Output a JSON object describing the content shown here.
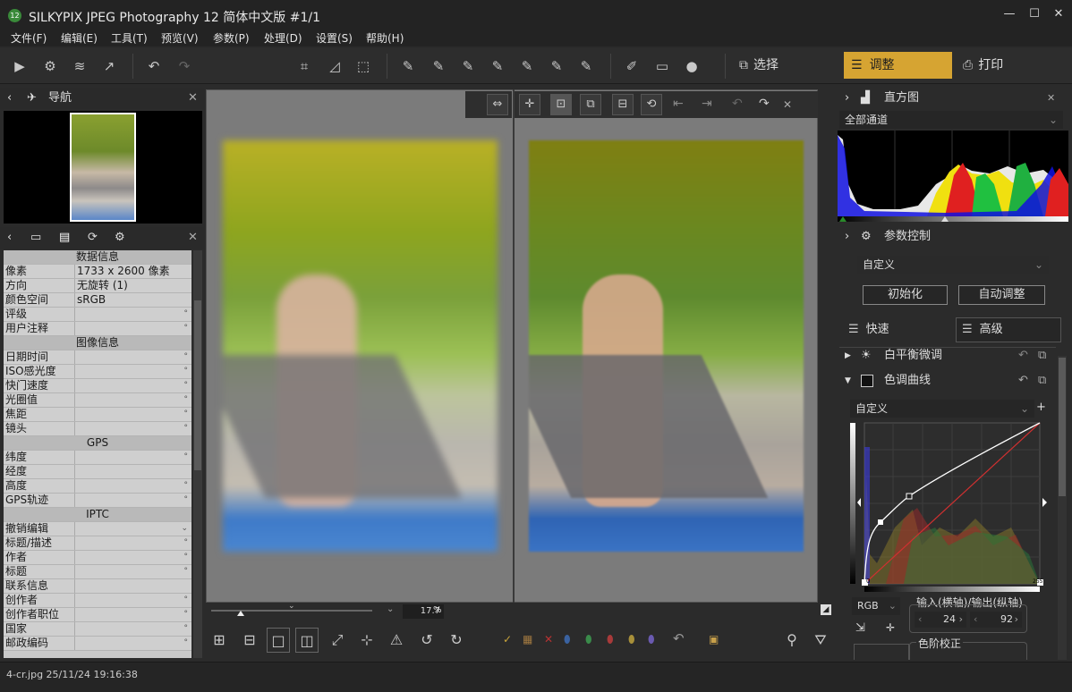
{
  "app": {
    "title": "SILKYPIX JPEG Photography 12 简体中文版  #1/1",
    "icon_label": "12",
    "min": "—",
    "max": "☐",
    "close": "✕"
  },
  "menu": [
    "文件(F)",
    "编辑(E)",
    "工具(T)",
    "预览(V)",
    "参数(P)",
    "处理(D)",
    "设置(S)",
    "帮助(H)"
  ],
  "toolbar": {
    "select_label": "选择",
    "adjust_label": "调整",
    "print_label": "打印"
  },
  "navigator": {
    "title": "导航"
  },
  "info": {
    "rows": [
      {
        "type": "section",
        "label": "数据信息"
      },
      {
        "label": "像素",
        "value": "1733 x 2600 像素"
      },
      {
        "label": "方向",
        "value": "无旋转 (1)"
      },
      {
        "label": "颜色空间",
        "value": "sRGB"
      },
      {
        "label": "评级",
        "value": "",
        "dot": "°"
      },
      {
        "label": "用户注释",
        "value": "",
        "dot": "°"
      },
      {
        "type": "section",
        "label": "图像信息"
      },
      {
        "label": "日期时间",
        "value": "",
        "dot": "°"
      },
      {
        "label": "ISO感光度",
        "value": "",
        "dot": "°"
      },
      {
        "label": "快门速度",
        "value": "",
        "dot": "°"
      },
      {
        "label": "光圈值",
        "value": "",
        "dot": "°"
      },
      {
        "label": "焦距",
        "value": "",
        "dot": "°"
      },
      {
        "label": "镜头",
        "value": "",
        "dot": "°"
      },
      {
        "type": "section",
        "label": "GPS"
      },
      {
        "label": "纬度",
        "value": "",
        "dot": "°"
      },
      {
        "label": "经度",
        "value": "",
        "dot": ""
      },
      {
        "label": "高度",
        "value": "",
        "dot": "°"
      },
      {
        "label": "GPS轨迹",
        "value": "",
        "dot": "°"
      },
      {
        "type": "section",
        "label": "IPTC"
      },
      {
        "label": "撤销编辑",
        "value": "",
        "dot": "⌄"
      },
      {
        "label": "标题/描述",
        "value": "",
        "dot": "°"
      },
      {
        "label": "作者",
        "value": "",
        "dot": "°"
      },
      {
        "label": "标题",
        "value": "",
        "dot": "°"
      },
      {
        "label": "联系信息",
        "value": "",
        "dot": ""
      },
      {
        "label": "创作者",
        "value": "",
        "dot": "°"
      },
      {
        "label": "创作者职位",
        "value": "",
        "dot": "°"
      },
      {
        "label": "国家",
        "value": "",
        "dot": "°"
      },
      {
        "label": "邮政编码",
        "value": "",
        "dot": "°"
      }
    ]
  },
  "viewer": {
    "zoom": "17.7",
    "zoom_unit": "%"
  },
  "status": {
    "text": "4-cr.jpg 25/11/24 19:16:38"
  },
  "histogram": {
    "title": "直方图",
    "channel": "全部通道"
  },
  "params": {
    "title": "参数控制",
    "preset": "自定义",
    "init_label": "初始化",
    "auto_label": "自动调整",
    "quick_label": "快速",
    "advanced_label": "高级"
  },
  "wb": {
    "title": "白平衡微调"
  },
  "curve": {
    "title": "色调曲线",
    "preset": "自定义",
    "channel": "RGB",
    "io_label": "输入(横轴)/输出(纵轴)",
    "input": "24",
    "output": "92",
    "min_label": "0",
    "max_label": "255"
  },
  "levels": {
    "title": "色阶校正"
  }
}
